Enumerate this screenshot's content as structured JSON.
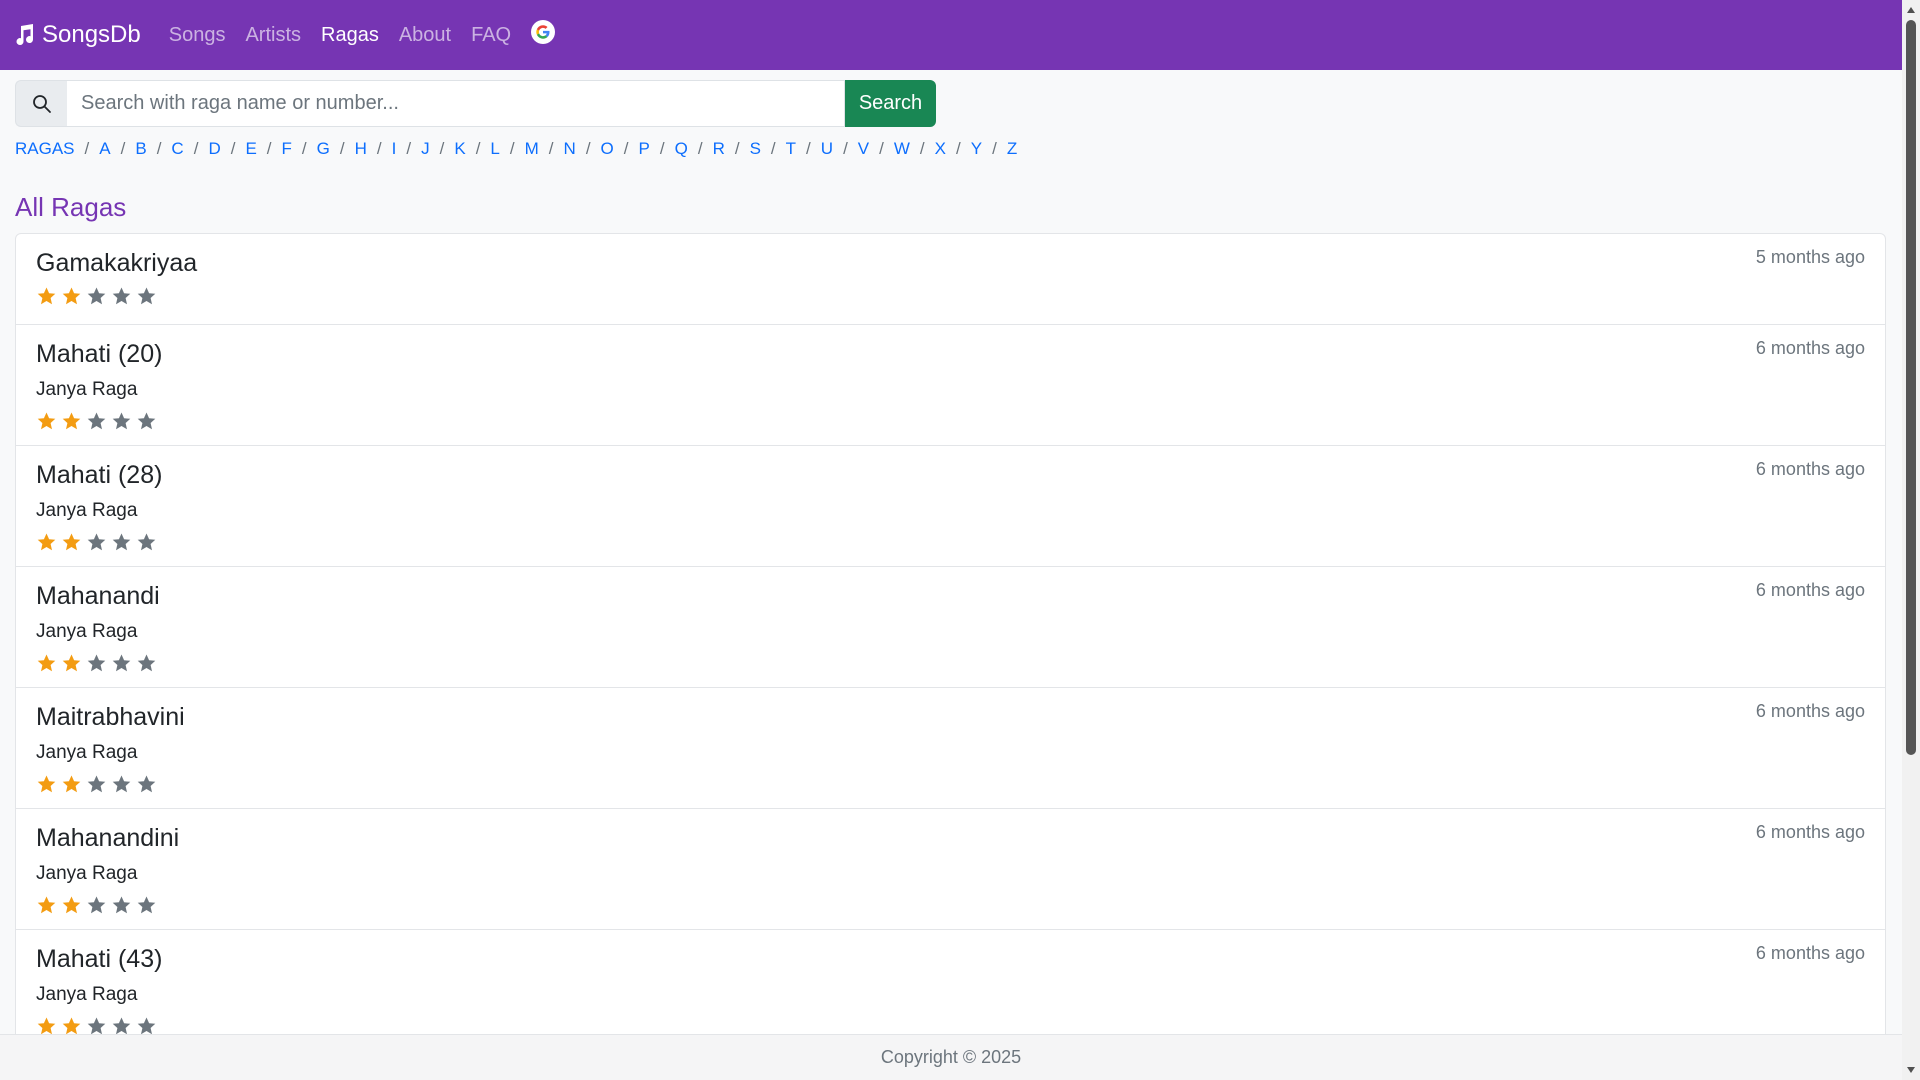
{
  "navbar": {
    "brand": "SongsDb",
    "links": [
      {
        "label": "Songs",
        "active": false
      },
      {
        "label": "Artists",
        "active": false
      },
      {
        "label": "Ragas",
        "active": true
      },
      {
        "label": "About",
        "active": false
      },
      {
        "label": "FAQ",
        "active": false
      }
    ],
    "google_icon": "google-icon",
    "color": "#7635b3"
  },
  "search": {
    "placeholder": "Search with raga name or number...",
    "value": "",
    "button_label": "Search",
    "button_color": "#198754"
  },
  "alphabet": {
    "root": "RAGAS",
    "letters": [
      "A",
      "B",
      "C",
      "D",
      "E",
      "F",
      "G",
      "H",
      "I",
      "J",
      "K",
      "L",
      "M",
      "N",
      "O",
      "P",
      "Q",
      "R",
      "S",
      "T",
      "U",
      "V",
      "W",
      "X",
      "Y",
      "Z"
    ],
    "separator": "/"
  },
  "heading": "All Ragas",
  "ragas": [
    {
      "name": "Gamakakriyaa",
      "type": "",
      "time": "5 months ago",
      "rating": 2,
      "max_rating": 5
    },
    {
      "name": "Mahati (20)",
      "type": "Janya Raga",
      "time": "6 months ago",
      "rating": 2,
      "max_rating": 5
    },
    {
      "name": "Mahati (28)",
      "type": "Janya Raga",
      "time": "6 months ago",
      "rating": 2,
      "max_rating": 5
    },
    {
      "name": "Mahanandi",
      "type": "Janya Raga",
      "time": "6 months ago",
      "rating": 2,
      "max_rating": 5
    },
    {
      "name": "Maitrabhavini",
      "type": "Janya Raga",
      "time": "6 months ago",
      "rating": 2,
      "max_rating": 5
    },
    {
      "name": "Mahanandini",
      "type": "Janya Raga",
      "time": "6 months ago",
      "rating": 2,
      "max_rating": 5
    },
    {
      "name": "Mahati (43)",
      "type": "Janya Raga",
      "time": "6 months ago",
      "rating": 2,
      "max_rating": 5
    }
  ],
  "star_colors": {
    "filled": "#f39c12",
    "empty": "#6c757d"
  },
  "footer": {
    "text": "Copyright © 2025"
  }
}
